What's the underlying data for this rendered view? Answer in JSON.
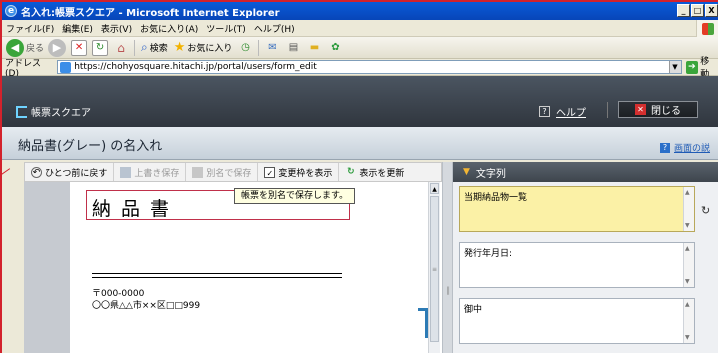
{
  "window": {
    "title": "名入れ:帳票スクエア - Microsoft Internet Explorer",
    "icon": "ie-icon",
    "controls": [
      "_",
      "□",
      "X"
    ]
  },
  "menu": {
    "items": [
      "ファイル(F)",
      "編集(E)",
      "表示(V)",
      "お気に入り(A)",
      "ツール(T)",
      "ヘルプ(H)"
    ]
  },
  "toolbar": {
    "back_label": "戻る",
    "search_label": "検索",
    "favorites_label": "お気に入り"
  },
  "address": {
    "label": "アドレス(D)",
    "url": "https://chohyosquare.hitachi.jp/portal/users/form_edit",
    "go_label": "移動"
  },
  "app": {
    "logo_text": "帳票スクエア",
    "help_label": "ヘルプ",
    "close_label": "閉じる"
  },
  "page": {
    "title": "納品書(グレー) の名入れ",
    "screen_help": "画面の説"
  },
  "worktoolbar": {
    "undo": "ひとつ前に戻す",
    "save": "上書き保存",
    "save_as": "別名で保存",
    "show_frame": "変更枠を表示",
    "refresh_view": "表示を更新"
  },
  "tooltip": {
    "text": "帳票を別名で保存します。"
  },
  "document": {
    "title": "納品書",
    "zip": "〒000-0000",
    "address": "〇〇県△△市××区□□999"
  },
  "panel": {
    "header": "文字列",
    "fields": [
      {
        "value": "当期納品物一覧"
      },
      {
        "value": "発行年月日:"
      },
      {
        "value": "御中"
      }
    ]
  },
  "colors": {
    "titlebar": "#0a5bd8",
    "frame_red": "#d3222c",
    "highlight_field": "#fbf1a6",
    "app_header": "#30363e"
  }
}
